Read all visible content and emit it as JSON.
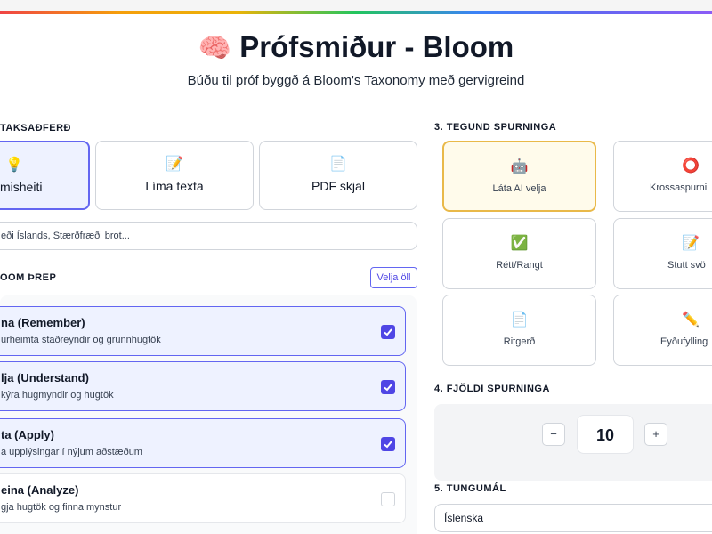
{
  "header": {
    "title_emoji": "🧠",
    "title": "Prófsmiður - Bloom",
    "subtitle": "Búðu til próf byggð á Bloom's Taxonomy með gervigreind"
  },
  "input_method": {
    "section_label": "TAKSAÐFERÐ",
    "options": [
      {
        "icon": "💡",
        "label": "misheiti",
        "selected": true
      },
      {
        "icon": "📝",
        "label": "Líma texta",
        "selected": false
      },
      {
        "icon": "📄",
        "label": "PDF skjal",
        "selected": false
      }
    ],
    "topic_value": "eði Íslands, Stærðfræði brot..."
  },
  "bloom": {
    "section_label": "OOM ÞREP",
    "select_all_label": "Velja öll",
    "levels": [
      {
        "title": "na (Remember)",
        "desc": "urheimta staðreyndir og grunnhugtök",
        "checked": true
      },
      {
        "title": "lja (Understand)",
        "desc": "kýra hugmyndir og hugtök",
        "checked": true
      },
      {
        "title": "ta (Apply)",
        "desc": "a upplýsingar í nýjum aðstæðum",
        "checked": true
      },
      {
        "title": "eina (Analyze)",
        "desc": "gja hugtök og finna mynstur",
        "checked": false
      }
    ]
  },
  "question_type": {
    "section_label": "3. TEGUND SPURNINGA",
    "options": [
      {
        "icon": "🤖",
        "label": "Láta AI velja",
        "selected": true
      },
      {
        "icon": "⭕",
        "label": "Krossaspurni",
        "selected": false
      },
      {
        "icon": "✅",
        "label": "Rétt/Rangt",
        "selected": false
      },
      {
        "icon": "📝",
        "label": "Stutt svö",
        "selected": false
      },
      {
        "icon": "📄",
        "label": "Ritgerð",
        "selected": false
      },
      {
        "icon": "✏️",
        "label": "Eyðufylling",
        "selected": false
      }
    ]
  },
  "question_count": {
    "section_label": "4. FJÖLDI SPURNINGA",
    "decrement": "−",
    "value": "10",
    "increment": "+"
  },
  "language": {
    "section_label": "5. TUNGUMÁL",
    "selected": "Íslenska"
  },
  "colors": {
    "accent": "#4f46e5",
    "selected_bg": "#eef2ff",
    "ai_selected_border": "#e9b949"
  }
}
